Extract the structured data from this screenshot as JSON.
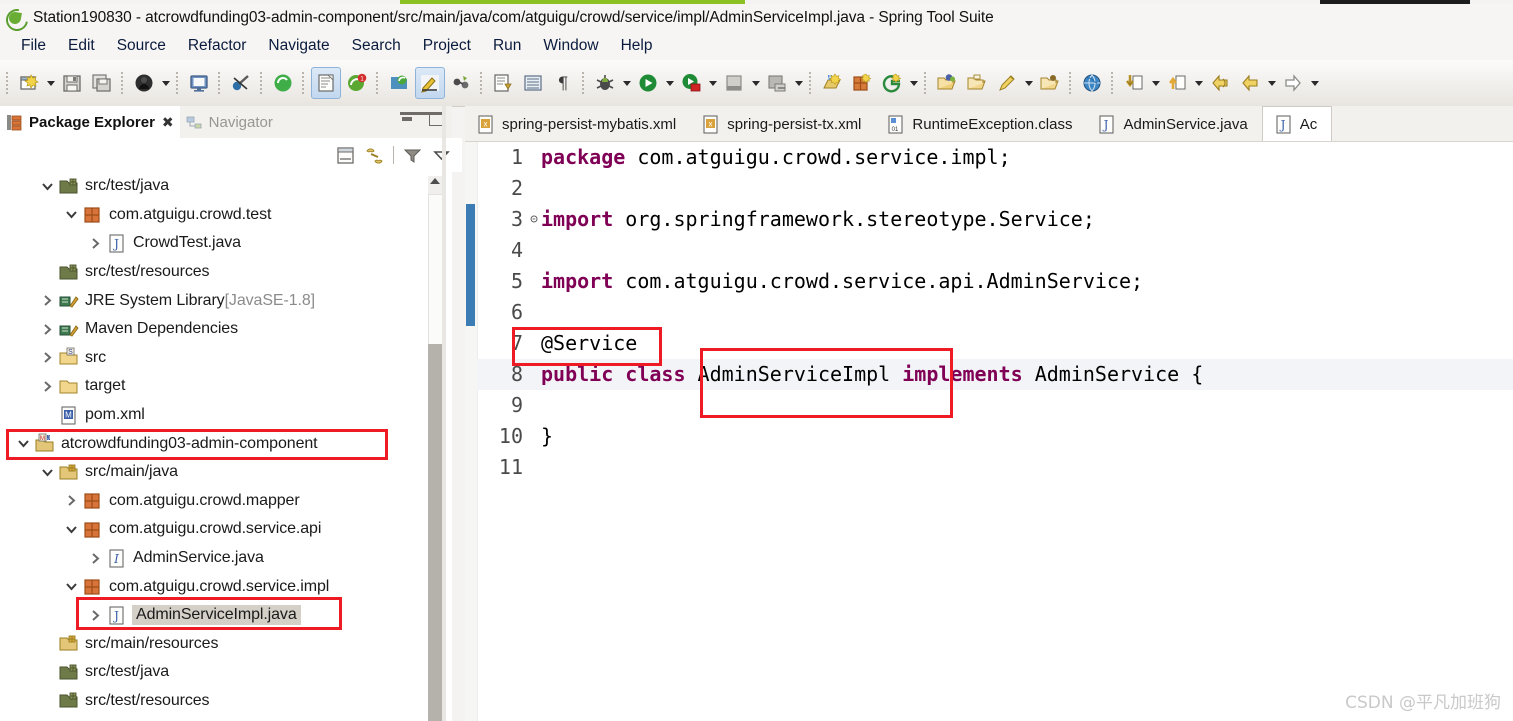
{
  "window": {
    "title": "Station190830 - atcrowdfunding03-admin-component/src/main/java/com/atguigu/crowd/service/impl/AdminServiceImpl.java - Spring Tool Suite",
    "logo_icon": "spring-tool-suite-logo-icon"
  },
  "menubar": {
    "items": [
      {
        "label": "File"
      },
      {
        "label": "Edit"
      },
      {
        "label": "Source"
      },
      {
        "label": "Refactor"
      },
      {
        "label": "Navigate"
      },
      {
        "label": "Search"
      },
      {
        "label": "Project"
      },
      {
        "label": "Run"
      },
      {
        "label": "Window"
      },
      {
        "label": "Help"
      }
    ]
  },
  "toolbar": {
    "groups": [
      {
        "buttons": [
          {
            "icon": "new-wizard-icon",
            "dropdown": true
          },
          {
            "icon": "save-icon",
            "dropdown": false
          },
          {
            "icon": "save-all-icon",
            "dropdown": false
          }
        ]
      },
      {
        "buttons": [
          {
            "icon": "boot-dashboard-icon",
            "dropdown": true
          }
        ]
      },
      {
        "buttons": [
          {
            "icon": "console-view-icon",
            "dropdown": false
          }
        ]
      },
      {
        "buttons": [
          {
            "icon": "skip-breakpoints-icon",
            "dropdown": false
          }
        ]
      },
      {
        "buttons": [
          {
            "icon": "spring-boot-app-icon",
            "dropdown": false
          },
          {
            "icon": "open-task-icon",
            "dropdown": false,
            "toggled": true
          },
          {
            "icon": "new-spring-project-icon",
            "dropdown": false
          }
        ]
      },
      {
        "buttons": [
          {
            "icon": "spring-config-icon",
            "dropdown": false
          },
          {
            "icon": "highlight-pen-icon",
            "dropdown": false,
            "toggled": true
          },
          {
            "icon": "link-editor-icon",
            "dropdown": false
          },
          {
            "icon": "open-type-icon",
            "dropdown": false
          },
          {
            "icon": "toggle-block-icon",
            "dropdown": false
          },
          {
            "icon": "pilcrow-icon",
            "dropdown": false
          }
        ]
      },
      {
        "buttons": [
          {
            "icon": "debug-icon",
            "dropdown": true
          },
          {
            "icon": "run-icon",
            "dropdown": true
          },
          {
            "icon": "run-server-icon",
            "dropdown": true
          },
          {
            "icon": "stop-icon",
            "dropdown": true
          },
          {
            "icon": "coverage-icon",
            "dropdown": true
          }
        ]
      },
      {
        "buttons": [
          {
            "icon": "new-java-class-icon",
            "dropdown": false
          },
          {
            "icon": "new-package-icon",
            "dropdown": false
          },
          {
            "icon": "new-git-repo-icon",
            "dropdown": true
          }
        ]
      },
      {
        "buttons": [
          {
            "icon": "open-resource-icon",
            "dropdown": false
          },
          {
            "icon": "open-folder-icon",
            "dropdown": false
          },
          {
            "icon": "search-marker-icon",
            "dropdown": true
          },
          {
            "icon": "open-file-icon",
            "dropdown": false
          }
        ]
      },
      {
        "buttons": [
          {
            "icon": "globe-icon",
            "dropdown": false
          }
        ]
      },
      {
        "buttons": [
          {
            "icon": "next-annotation-icon",
            "dropdown": true
          },
          {
            "icon": "previous-annotation-icon",
            "dropdown": true
          },
          {
            "icon": "back-history-icon",
            "dropdown": false
          },
          {
            "icon": "forward-history-icon",
            "dropdown": true
          },
          {
            "icon": "forward-arrow-icon",
            "dropdown": true
          }
        ]
      }
    ]
  },
  "explorer": {
    "tabs": [
      {
        "label": "Package Explorer",
        "icon": "package-explorer-icon",
        "active": true,
        "closable": true
      },
      {
        "label": "Navigator",
        "icon": "navigator-icon",
        "active": false,
        "closable": false
      }
    ],
    "window_buttons": [
      {
        "name": "minimize"
      },
      {
        "name": "maximize"
      }
    ],
    "view_toolbar": [
      {
        "icon": "collapse-all-icon"
      },
      {
        "icon": "link-with-editor-icon"
      },
      {
        "icon": "view-filter-icon"
      },
      {
        "icon": "view-menu-icon"
      }
    ],
    "tree": [
      {
        "label": "src/test/java",
        "indent": 1,
        "twisty": "open",
        "icon": "source-folder-icon"
      },
      {
        "label": "com.atguigu.crowd.test",
        "indent": 2,
        "twisty": "open",
        "icon": "package-icon"
      },
      {
        "label": "CrowdTest.java",
        "indent": 3,
        "twisty": "closed",
        "icon": "java-file-icon"
      },
      {
        "label": "src/test/resources",
        "indent": 1,
        "twisty": "none",
        "icon": "source-folder-icon"
      },
      {
        "label": "JRE System Library",
        "suffix": " [JavaSE-1.8]",
        "indent": 1,
        "twisty": "closed",
        "icon": "library-icon"
      },
      {
        "label": "Maven Dependencies",
        "indent": 1,
        "twisty": "closed",
        "icon": "library-icon"
      },
      {
        "label": "src",
        "indent": 1,
        "twisty": "closed",
        "icon": "folder-s-icon"
      },
      {
        "label": "target",
        "indent": 1,
        "twisty": "closed",
        "icon": "folder-icon"
      },
      {
        "label": "pom.xml",
        "indent": 1,
        "twisty": "none",
        "icon": "maven-pom-icon"
      },
      {
        "label": "atcrowdfunding03-admin-component",
        "indent": 0,
        "twisty": "open",
        "icon": "maven-project-icon",
        "highlight_box": true
      },
      {
        "label": "src/main/java",
        "indent": 1,
        "twisty": "open",
        "icon": "source-folder-main-icon"
      },
      {
        "label": "com.atguigu.crowd.mapper",
        "indent": 2,
        "twisty": "closed",
        "icon": "package-icon"
      },
      {
        "label": "com.atguigu.crowd.service.api",
        "indent": 2,
        "twisty": "open",
        "icon": "package-icon"
      },
      {
        "label": "AdminService.java",
        "indent": 3,
        "twisty": "closed",
        "icon": "java-interface-icon"
      },
      {
        "label": "com.atguigu.crowd.service.impl",
        "indent": 2,
        "twisty": "open",
        "icon": "package-icon"
      },
      {
        "label": "AdminServiceImpl.java",
        "indent": 3,
        "twisty": "closed",
        "icon": "java-file-icon",
        "selected": true,
        "highlight_box": true
      },
      {
        "label": "src/main/resources",
        "indent": 1,
        "twisty": "none",
        "icon": "source-folder-main-icon"
      },
      {
        "label": "src/test/java",
        "indent": 1,
        "twisty": "none",
        "icon": "source-folder-icon"
      },
      {
        "label": "src/test/resources",
        "indent": 1,
        "twisty": "none",
        "icon": "source-folder-icon"
      }
    ]
  },
  "editor": {
    "tabs": [
      {
        "label": "spring-persist-mybatis.xml",
        "icon": "xml-file-icon",
        "active": false
      },
      {
        "label": "spring-persist-tx.xml",
        "icon": "xml-file-icon",
        "active": false
      },
      {
        "label": "RuntimeException.class",
        "icon": "class-file-icon",
        "active": false
      },
      {
        "label": "AdminService.java",
        "icon": "java-interface-icon",
        "active": false
      },
      {
        "label": "Ac",
        "icon": "java-file-icon",
        "active": true
      }
    ],
    "lines": [
      {
        "num": "1",
        "fold": "",
        "tokens": [
          {
            "t": "package",
            "c": "kw"
          },
          {
            "t": " com.atguigu.crowd.service.impl;",
            "c": "plain"
          }
        ]
      },
      {
        "num": "2",
        "fold": "",
        "tokens": []
      },
      {
        "num": "3",
        "fold": "⊝",
        "tokens": [
          {
            "t": "import",
            "c": "kw"
          },
          {
            "t": " org.springframework.stereotype.Service;",
            "c": "plain"
          }
        ]
      },
      {
        "num": "4",
        "fold": "",
        "tokens": []
      },
      {
        "num": "5",
        "fold": "",
        "tokens": [
          {
            "t": "import",
            "c": "kw"
          },
          {
            "t": " com.atguigu.crowd.service.api.AdminService;",
            "c": "plain"
          }
        ]
      },
      {
        "num": "6",
        "fold": "",
        "tokens": []
      },
      {
        "num": "7",
        "fold": "",
        "tokens": [
          {
            "t": "@Service",
            "c": "ann"
          }
        ]
      },
      {
        "num": "8",
        "fold": "",
        "highlighted": true,
        "tokens": [
          {
            "t": "public class",
            "c": "kw"
          },
          {
            "t": " AdminServiceImpl ",
            "c": "plain"
          },
          {
            "t": "implements",
            "c": "kw"
          },
          {
            "t": " AdminService {",
            "c": "plain"
          }
        ]
      },
      {
        "num": "9",
        "fold": "",
        "tokens": []
      },
      {
        "num": "10",
        "fold": "",
        "tokens": [
          {
            "t": "}",
            "c": "plain"
          }
        ]
      },
      {
        "num": "11",
        "fold": "",
        "tokens": []
      }
    ]
  },
  "annotations": {
    "color": "#ee1b24",
    "boxes": [
      {
        "name": "project-node-callout"
      },
      {
        "name": "service-impl-file-callout"
      },
      {
        "name": "service-annotation-callout"
      },
      {
        "name": "class-name-callout"
      }
    ]
  },
  "watermark": {
    "text": "CSDN @平凡加班狗"
  },
  "colors": {
    "keyword": "#7f0055",
    "annotation_red": "#ee1b24",
    "ruler_blue": "#3b7cb5",
    "selection_gray": "#d4d0c8",
    "green_bar": "#8cc123"
  }
}
